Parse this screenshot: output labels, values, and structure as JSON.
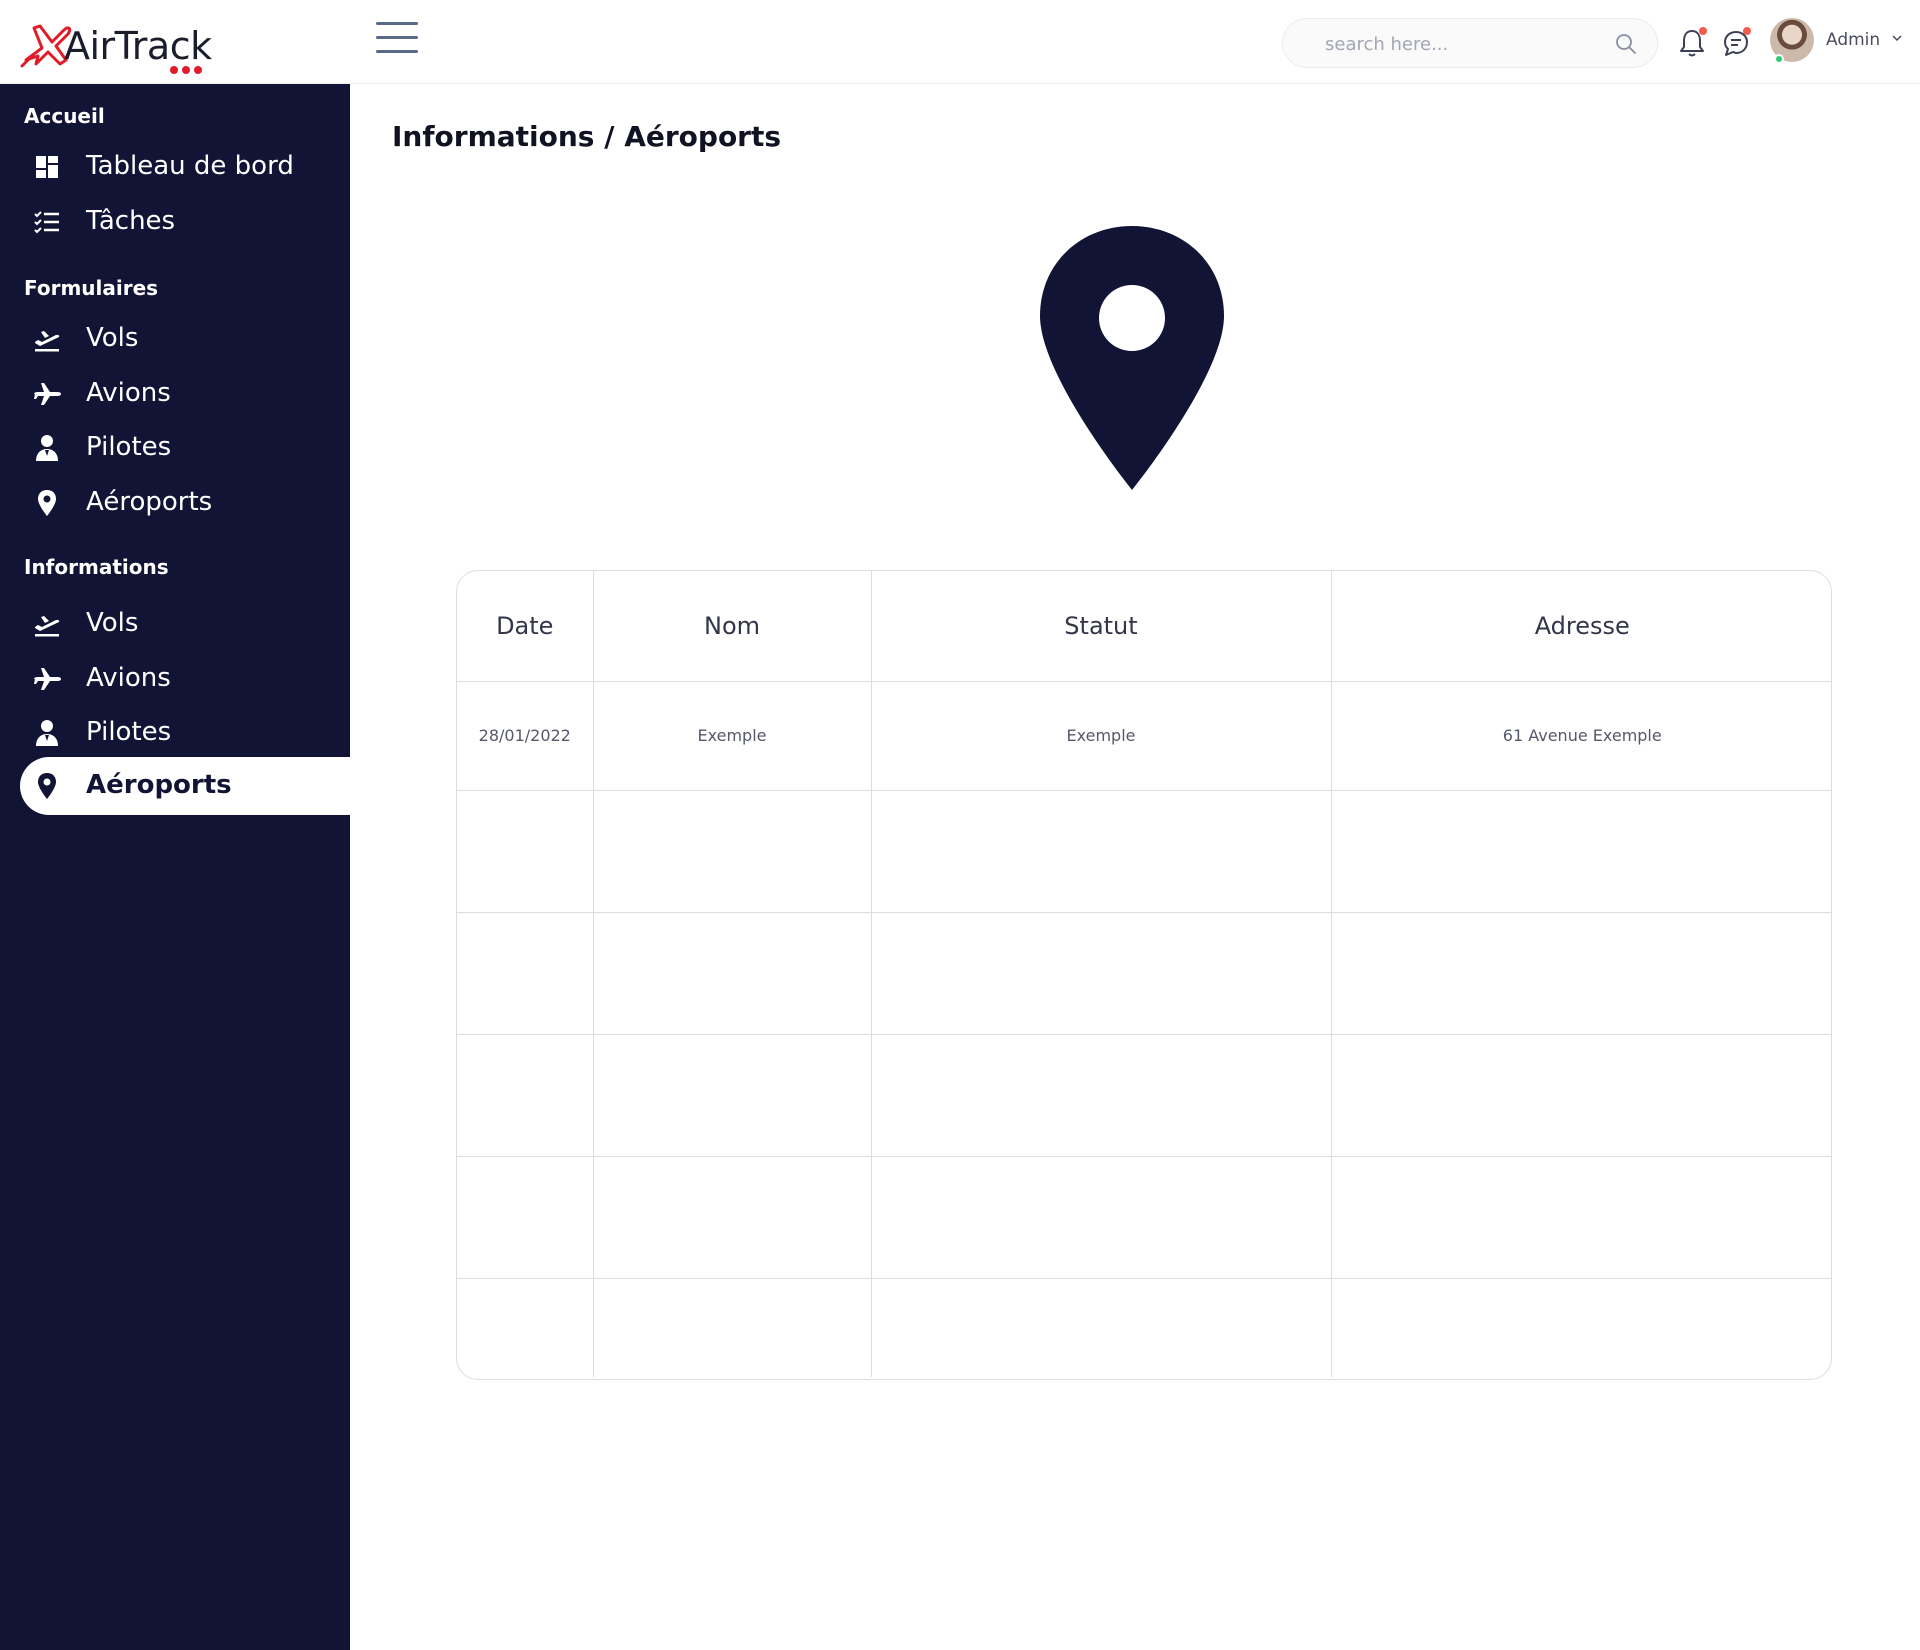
{
  "app": {
    "brand": "AirTrack",
    "colors": {
      "sidebar": "#121435",
      "accent": "#e01c2a",
      "notification": "#f25c4c",
      "online": "#2ecc71"
    }
  },
  "header": {
    "search_placeholder": "search here...",
    "user_name": "Admin",
    "icons": [
      "menu-icon",
      "search-icon",
      "bell-icon",
      "chat-icon",
      "chevron-down-icon"
    ]
  },
  "sidebar": {
    "sections": [
      {
        "title": "Accueil",
        "items": [
          {
            "label": "Tableau de bord",
            "icon": "dashboard-icon"
          },
          {
            "label": "Tâches",
            "icon": "tasks-icon"
          }
        ]
      },
      {
        "title": "Formulaires",
        "items": [
          {
            "label": "Vols",
            "icon": "flight-takeoff-icon"
          },
          {
            "label": "Avions",
            "icon": "airplane-icon"
          },
          {
            "label": "Pilotes",
            "icon": "pilot-icon"
          },
          {
            "label": "Aéroports",
            "icon": "location-pin-icon"
          }
        ]
      },
      {
        "title": "Informations",
        "items": [
          {
            "label": "Vols",
            "icon": "flight-takeoff-icon"
          },
          {
            "label": "Avions",
            "icon": "airplane-icon"
          },
          {
            "label": "Pilotes",
            "icon": "pilot-icon"
          },
          {
            "label": "Aéroports",
            "icon": "location-pin-icon",
            "active": true
          }
        ]
      }
    ]
  },
  "main": {
    "title": "Informations / Aéroports",
    "hero_icon": "location-pin-icon",
    "table": {
      "columns": [
        "Date",
        "Nom",
        "Statut",
        "Adresse"
      ],
      "rows": [
        [
          "28/01/2022",
          "Exemple",
          "Exemple",
          "61 Avenue Exemple"
        ],
        [
          "",
          "",
          "",
          ""
        ],
        [
          "",
          "",
          "",
          ""
        ],
        [
          "",
          "",
          "",
          ""
        ],
        [
          "",
          "",
          "",
          ""
        ],
        [
          "",
          "",
          "",
          ""
        ]
      ]
    }
  }
}
